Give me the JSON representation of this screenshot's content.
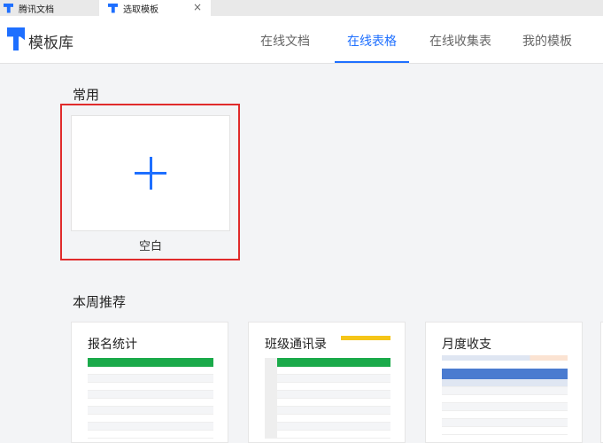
{
  "tabs": [
    {
      "label": "腾讯文档"
    },
    {
      "label": "选取模板",
      "close": "×"
    }
  ],
  "header": {
    "brand": "模板库",
    "nav": [
      {
        "label": "在线文档"
      },
      {
        "label": "在线表格"
      },
      {
        "label": "在线收集表"
      },
      {
        "label": "我的模板"
      }
    ],
    "active_nav": "在线表格"
  },
  "common": {
    "title": "常用",
    "blank_label": "空白"
  },
  "weekly": {
    "title": "本周推荐",
    "cards": [
      {
        "title": "报名统计"
      },
      {
        "title": "班级通讯录"
      },
      {
        "title": "月度收支"
      }
    ]
  },
  "colors": {
    "accent": "#1e6fff",
    "highlight": "#e02b2b",
    "sheet_header": "#1aaa4a"
  }
}
